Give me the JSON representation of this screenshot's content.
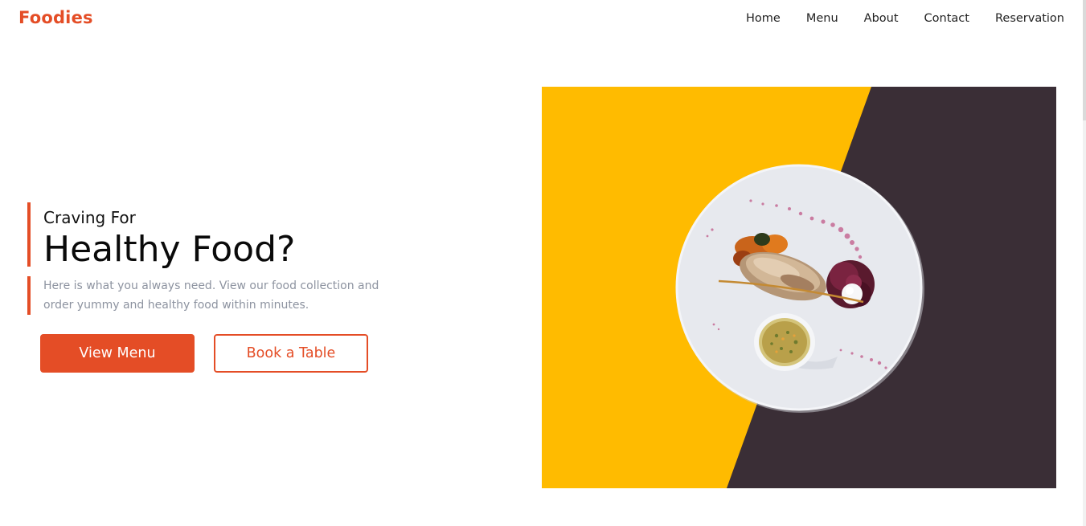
{
  "brand": {
    "name": "Foodies",
    "color": "#e44d26"
  },
  "nav": {
    "items": [
      {
        "label": "Home"
      },
      {
        "label": "Menu"
      },
      {
        "label": "About"
      },
      {
        "label": "Contact"
      },
      {
        "label": "Reservation"
      }
    ]
  },
  "hero": {
    "subtitle": "Craving For",
    "title": "Healthy Food?",
    "description": "Here is what you always need. View our food collection and order yummy and healthy food within minutes.",
    "primary_button": "View Menu",
    "secondary_button": "Book a Table",
    "image": {
      "icon": "plated-food-image",
      "colors": {
        "yellow": "#ffbb00",
        "dark": "#3a2e36",
        "plate": "#e7e9ee"
      }
    }
  }
}
